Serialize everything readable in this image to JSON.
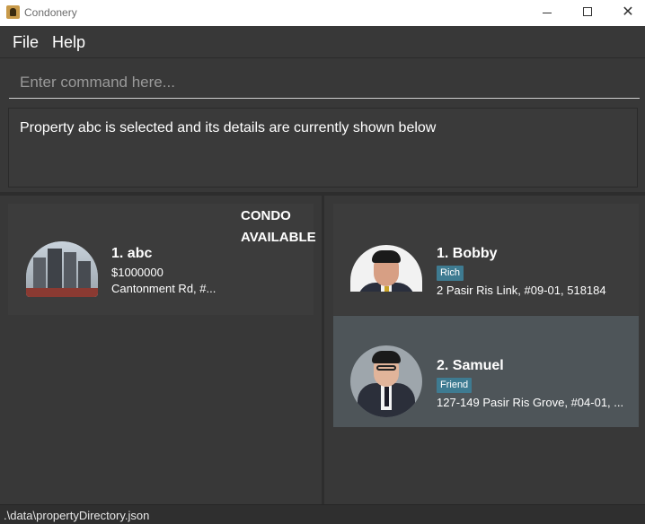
{
  "window": {
    "title": "Condonery",
    "minimize_symbol": "",
    "close_symbol": "✕"
  },
  "menu": {
    "file": "File",
    "help": "Help"
  },
  "command": {
    "placeholder": "Enter command here..."
  },
  "result": {
    "message": "Property abc is selected and its details are currently shown below"
  },
  "property_list": [
    {
      "index_name": "1.  abc",
      "price": "$1000000",
      "address": "Cantonment Rd, #...",
      "type": "CONDO",
      "status": "AVAILABLE"
    }
  ],
  "client_list": [
    {
      "index_name": "1.  Bobby",
      "tag": "Rich",
      "address": "2 Pasir Ris Link, #09-01, 518184",
      "selected": false
    },
    {
      "index_name": "2.  Samuel",
      "tag": "Friend",
      "address": "127-149 Pasir Ris Grove, #04-01, ...",
      "selected": true
    }
  ],
  "status_bar": {
    "path": ".\\data\\propertyDirectory.json"
  },
  "colors": {
    "background": "#383838",
    "selected_card": "#4e5559",
    "tag": "#3e7b91"
  }
}
